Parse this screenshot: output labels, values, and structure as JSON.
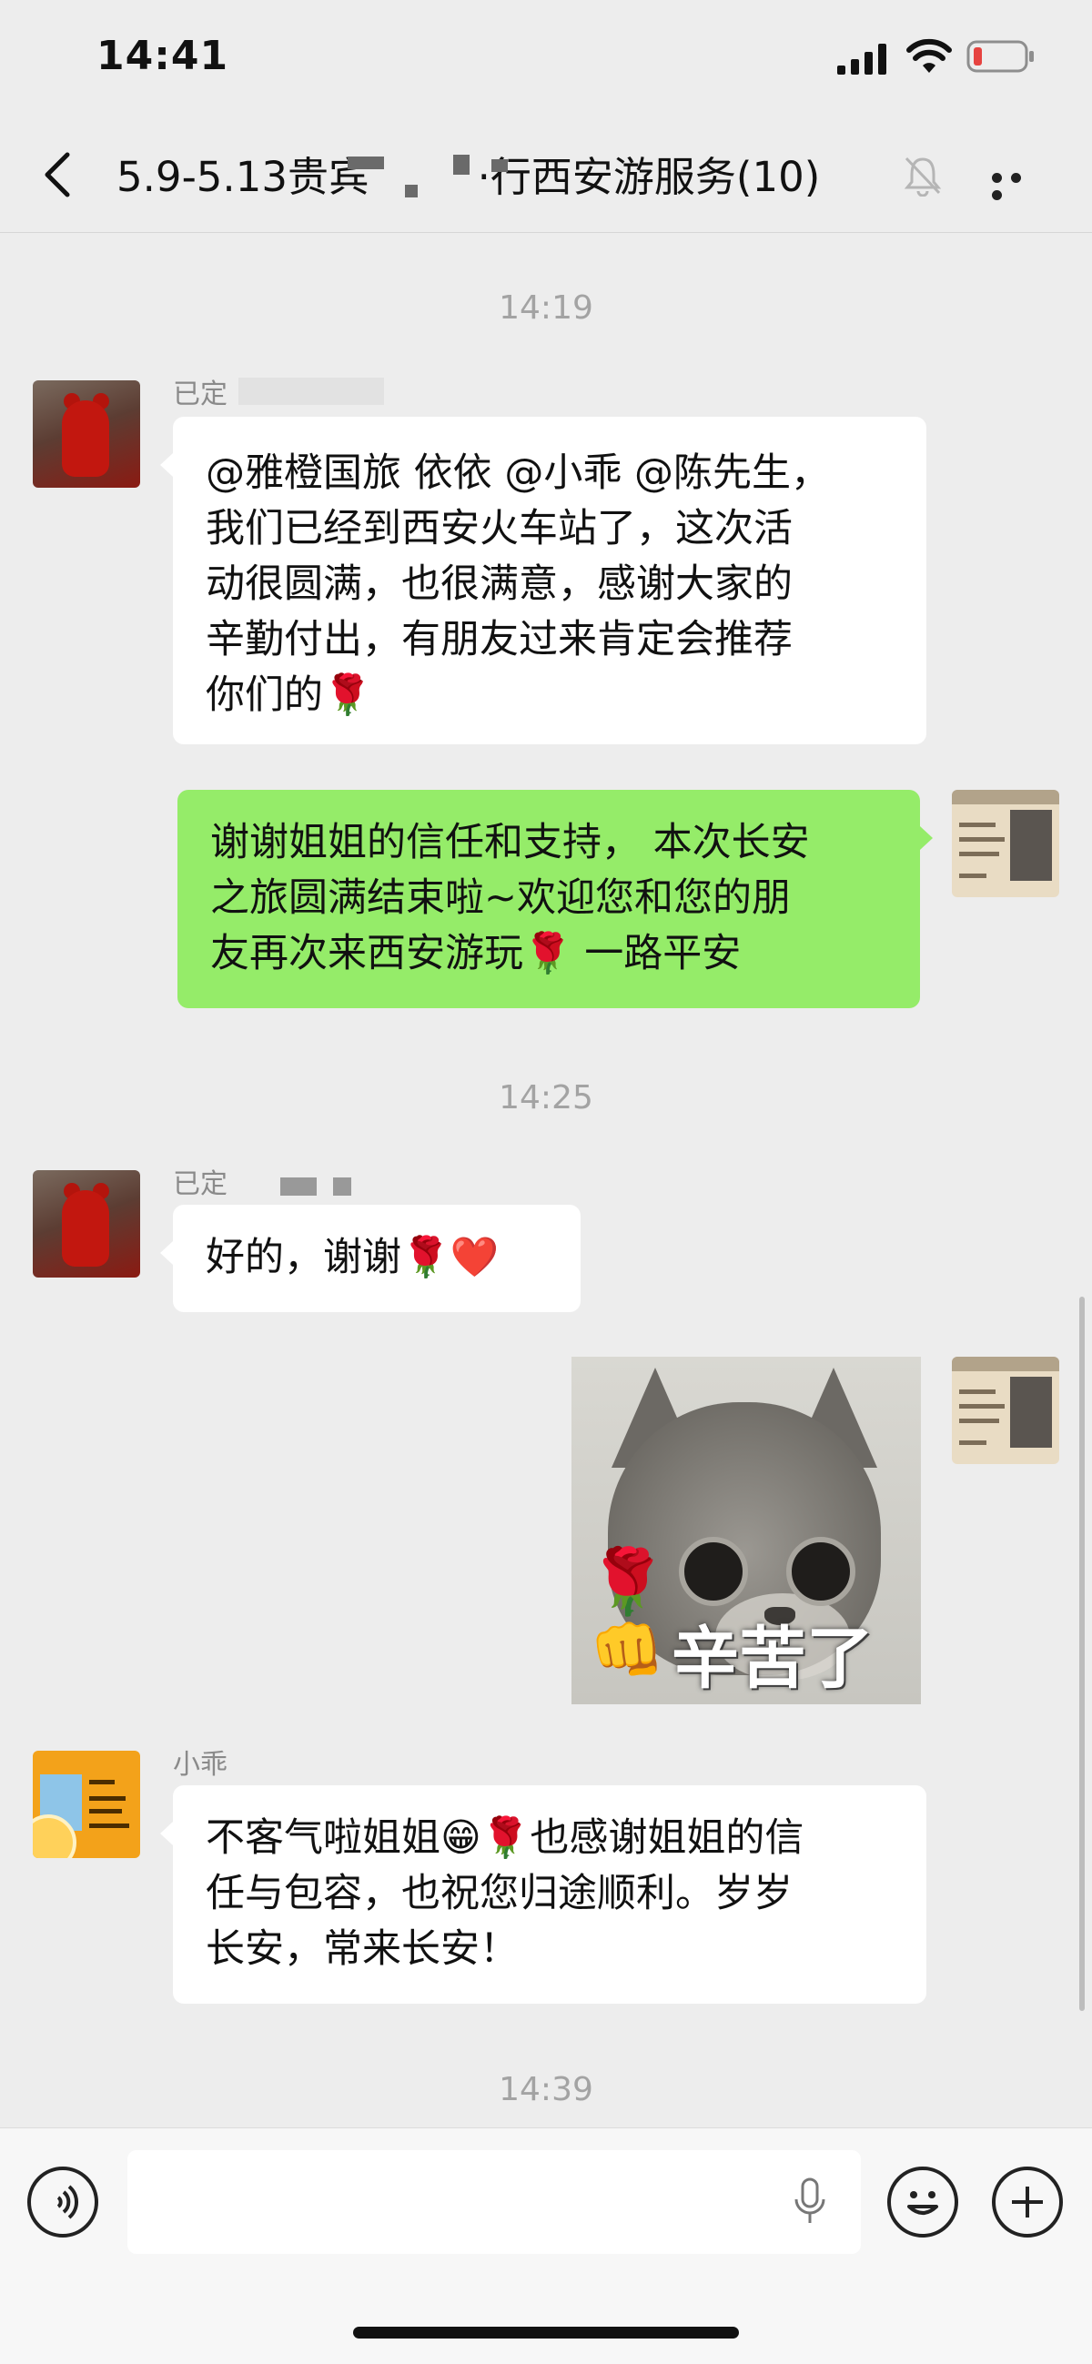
{
  "status_bar": {
    "time": "14:41",
    "battery_color": "#e64340"
  },
  "nav": {
    "title": "5.9-5.13贵宾　 　  ·行西安游服务(10)",
    "muted": true,
    "back_icon": "chevron-left-icon",
    "more_icon": "ellipsis-icon"
  },
  "timestamps": [
    "14:19",
    "14:25",
    "14:39"
  ],
  "messages": [
    {
      "side": "in",
      "sender": "已定",
      "avatar": "red-bear-avatar",
      "lines": [
        "@雅橙国旅 依依 @小乖 @陈先生，",
        "我们已经到西安火车站了，这次活",
        "动很圆满，也很满意，感谢大家的",
        "辛勤付出，有朋友过来肯定会推荐",
        "你们的🌹"
      ]
    },
    {
      "side": "out",
      "avatar": "business-card-avatar",
      "lines": [
        "谢谢姐姐的信任和支持， 本次长安",
        "之旅圆满结束啦~欢迎您和您的朋",
        "友再次来西安游玩🌹 一路平安"
      ]
    },
    {
      "side": "in",
      "sender": "已定",
      "avatar": "red-bear-avatar",
      "lines": [
        "好的，谢谢🌹❤️"
      ]
    },
    {
      "side": "out",
      "avatar": "business-card-avatar",
      "type": "sticker",
      "sticker_text": "辛苦了"
    },
    {
      "side": "in",
      "sender": "小乖",
      "avatar": "orange-card-avatar",
      "lines": [
        "不客气啦姐姐😁🌹也感谢姐姐的信",
        "任与包容，也祝您归途顺利。岁岁",
        "长安，常来长安！"
      ]
    }
  ],
  "input_bar": {
    "voice_icon": "voice-icon",
    "mic_icon": "microphone-icon",
    "emoji_icon": "emoji-icon",
    "plus_icon": "plus-icon"
  },
  "colors": {
    "background": "#ededed",
    "bubble_in": "#ffffff",
    "bubble_out": "#95ec69",
    "timestamp": "#a3a3a3"
  }
}
